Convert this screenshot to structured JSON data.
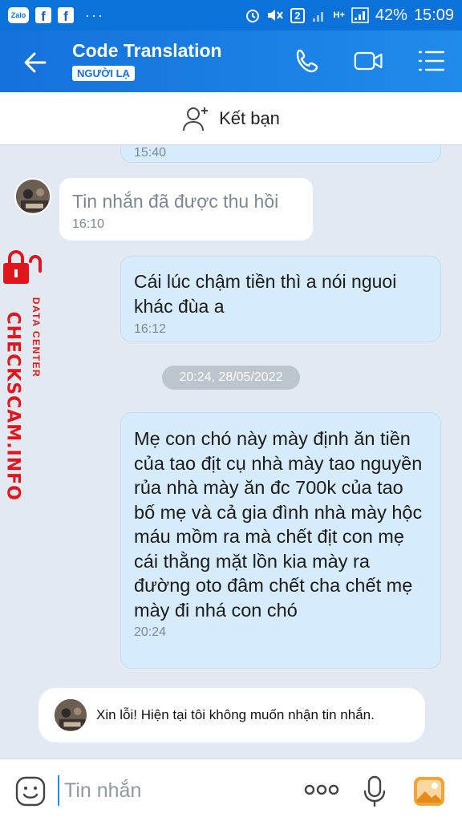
{
  "status_bar": {
    "app_badge": "Zalo",
    "fb_letter": "f",
    "dots": "···",
    "sim_number": "2",
    "network": "H+",
    "battery": "42%",
    "time": "15:09"
  },
  "header": {
    "title": "Code Translation",
    "tag": "NGƯỜI LẠ"
  },
  "add_friend": {
    "label": "Kết bạn"
  },
  "messages": [
    {
      "direction": "out",
      "text": "",
      "time": "15:40"
    },
    {
      "direction": "in",
      "text": "Tin nhắn đã được thu hồi",
      "time": "16:10"
    },
    {
      "direction": "out",
      "text": "Cái lúc chậm tiền thì a nói nguoi khác đùa a",
      "time": "16:12"
    },
    {
      "direction": "out",
      "text": "Mẹ con chó này mày định ăn tiền của tao địt cụ nhà mày tao nguyền rủa nhà mày ăn đc 700k của tao bố mẹ và cả gia đình nhà mày hộc máu mồm ra mà chết địt con mẹ cái thằng mặt lồn kia mày ra đường oto đâm chết cha chết mẹ mày đi nhá con chó",
      "time": "20:24"
    }
  ],
  "date_separator": "20:24, 28/05/2022",
  "notice": {
    "text": "Xin lỗi! Hiện tại tôi không muốn nhận tin nhắn."
  },
  "watermark": {
    "brand": "CHECKSCAM.INFO",
    "sub": "DATA CENTER"
  },
  "input": {
    "placeholder": "Tin nhắn"
  },
  "colors": {
    "header": "#1571dc",
    "out_bubble": "#d6ecfd",
    "watermark": "#e0161e"
  },
  "icons": [
    "back-icon",
    "phone-icon",
    "video-icon",
    "menu-icon",
    "add-user-icon",
    "emoji-icon",
    "more-icon",
    "mic-icon",
    "image-icon",
    "lock-icon"
  ]
}
